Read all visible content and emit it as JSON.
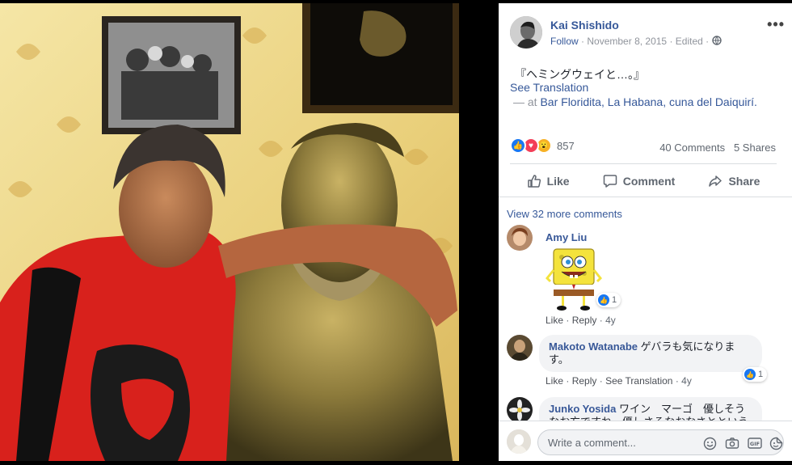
{
  "post": {
    "author": "Kai Shishido",
    "follow": "Follow",
    "date": "November 8, 2015",
    "edited": "Edited",
    "text": "『ヘミングウェイと…。』",
    "see_translation": "See Translation",
    "at_prefix": "— at ",
    "place": "Bar Floridita, La Habana, cuna del Daiquirí.",
    "reaction_count": "857",
    "comments_count": "40 Comments",
    "shares_count": "5 Shares"
  },
  "actions": {
    "like": "Like",
    "comment": "Comment",
    "share": "Share"
  },
  "comments_section": {
    "view_more": "View 32 more comments",
    "items": [
      {
        "author": "Amy Liu",
        "text": "",
        "links": [
          "Like",
          "Reply"
        ],
        "age": "4y",
        "reactions": "1"
      },
      {
        "author": "Makoto Watanabe",
        "text": "ゲバラも気になります。",
        "links": [
          "Like",
          "Reply",
          "See Translation"
        ],
        "age": "4y",
        "reactions": "1"
      },
      {
        "author": "Junko Yosida",
        "text": "ワイン　マーゴ　優しそうなお方ですね。優しさるなおなさとというべき"
      }
    ]
  },
  "composer": {
    "placeholder": "Write a comment..."
  },
  "colors": {
    "link": "#365899",
    "muted": "#90949c",
    "like_blue": "#1877f2",
    "love_red": "#f33e58",
    "wow_yellow": "#f7b125"
  },
  "icons": [
    "more-icon",
    "globe-icon",
    "like-icon",
    "comment-icon",
    "share-icon",
    "emoji-icon",
    "camera-icon",
    "gif-icon",
    "sticker-icon"
  ]
}
